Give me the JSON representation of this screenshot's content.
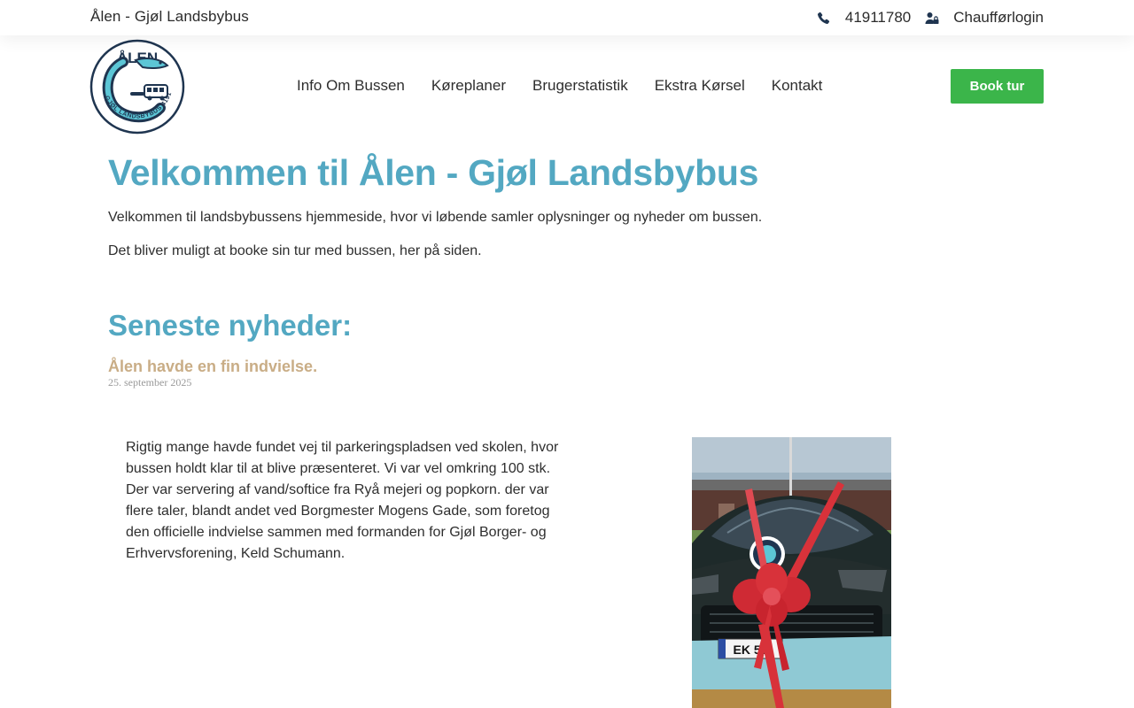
{
  "topbar": {
    "site_name": "Ålen - Gjøl Landsbybus",
    "phone": "41911780",
    "login": "Chaufførlogin",
    "icons": [
      "phone-icon",
      "user-lock-icon"
    ]
  },
  "header": {
    "logo": {
      "top_text": "ÅLEN",
      "ring_text": "GJØL LANDSBYBUS 41911780"
    },
    "nav": [
      "Info Om Bussen",
      "Køreplaner",
      "Brugerstatistik",
      "Ekstra Kørsel",
      "Kontakt"
    ],
    "book_button": "Book tur"
  },
  "main": {
    "title": "Velkommen til Ålen - Gjøl Landsbybus",
    "intro": "Velkommen til landsbybussens hjemmeside, hvor vi løbende samler oplysninger og nyheder om bussen.",
    "intro2": "Det bliver muligt at booke sin tur med bussen, her på siden.",
    "news_heading": "Seneste nyheder:",
    "post": {
      "title": "Ålen havde en fin indvielse.",
      "date": "25. september 2025",
      "body": "Rigtig mange havde fundet vej til parkeringspladsen ved skolen, hvor bussen holdt klar til at blive præsenteret. Vi var vel omkring 100 stk. Der var servering af vand/softice fra Ryå mejeri og popkorn. der var flere taler, blandt andet ved Borgmester Mogens Gade, som foretog den officielle indvielse sammen med formanden for Gjøl Borger- og Erhvervsforening, Keld Schumann."
    }
  },
  "colors": {
    "accent_blue": "#53a8c2",
    "button_green": "#3bb54a",
    "post_title": "#c9ad86",
    "logo_navy": "#1f3550"
  }
}
